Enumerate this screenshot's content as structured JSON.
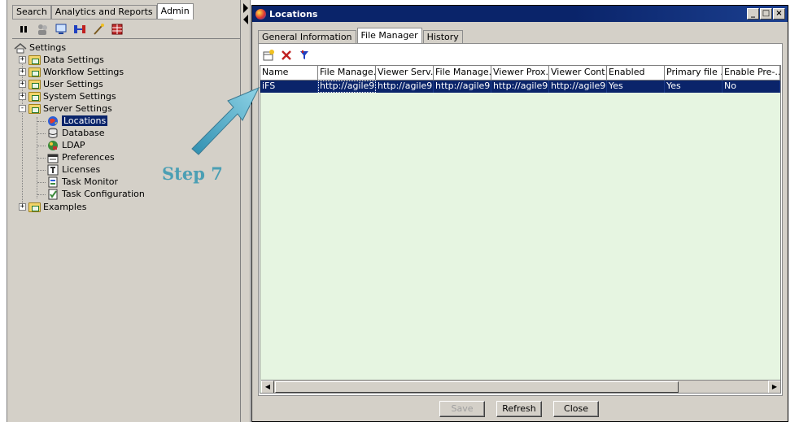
{
  "top_tabs": [
    {
      "label": "Search",
      "active": false
    },
    {
      "label": "Analytics and Reports",
      "active": false
    },
    {
      "label": "Admin",
      "active": true
    }
  ],
  "left_toolbar": [
    "pause-icon",
    "users-icon",
    "monitor-icon",
    "relationship-icon",
    "wand-icon",
    "grid-icon"
  ],
  "tree": {
    "root": "Settings",
    "items": [
      {
        "label": "Data Settings",
        "level": 1,
        "expander": "+"
      },
      {
        "label": "Workflow Settings",
        "level": 1,
        "expander": "+"
      },
      {
        "label": "User Settings",
        "level": 1,
        "expander": "+"
      },
      {
        "label": "System Settings",
        "level": 1,
        "expander": "+"
      },
      {
        "label": "Server Settings",
        "level": 1,
        "expander": "-"
      },
      {
        "label": "Locations",
        "level": 2,
        "icon": "globe-icon",
        "selected": true
      },
      {
        "label": "Database",
        "level": 2,
        "icon": "database-icon"
      },
      {
        "label": "LDAP",
        "level": 2,
        "icon": "ldap-icon"
      },
      {
        "label": "Preferences",
        "level": 2,
        "icon": "preferences-icon"
      },
      {
        "label": "Licenses",
        "level": 2,
        "icon": "license-icon"
      },
      {
        "label": "Task Monitor",
        "level": 2,
        "icon": "task-monitor-icon"
      },
      {
        "label": "Task Configuration",
        "level": 2,
        "icon": "task-config-icon"
      },
      {
        "label": "Examples",
        "level": 1,
        "expander": "+"
      }
    ]
  },
  "annotation": {
    "step": "Step 7",
    "color": "#4b9fb4"
  },
  "window": {
    "title": "Locations",
    "controls": [
      "_",
      "□",
      "×"
    ],
    "tabs": [
      {
        "label": "General Information",
        "active": false
      },
      {
        "label": "File Manager",
        "active": true
      },
      {
        "label": "History",
        "active": false
      }
    ],
    "grid_toolbar": [
      "add-row-icon",
      "delete-icon",
      "filter-icon"
    ],
    "columns": [
      "Name",
      "File Manage...",
      "Viewer Serv...",
      "File Manage...",
      "Viewer Prox...",
      "Viewer Cont...",
      "Enabled",
      "Primary file ...",
      "Enable Pre-..."
    ],
    "rows": [
      [
        "iFS",
        "http://agile9...",
        "http://agile9...",
        "http://agile9...",
        "http://agile9...",
        "http://agile9...",
        "Yes",
        "Yes",
        "No"
      ]
    ],
    "buttons": {
      "save": "Save",
      "refresh": "Refresh",
      "close": "Close"
    }
  },
  "colors": {
    "selection": "#0a246a",
    "grid_bg": "#e6f5e1",
    "chrome": "#d4d0c8"
  }
}
